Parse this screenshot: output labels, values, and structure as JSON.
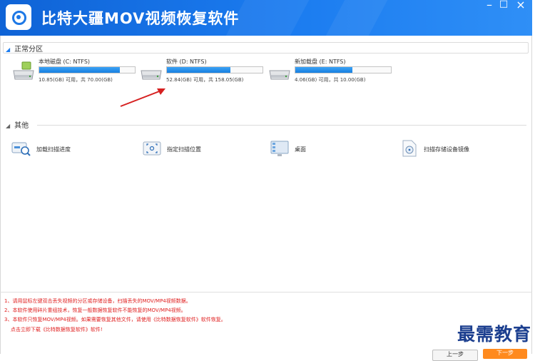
{
  "app": {
    "title": "比特大疆MOV视频恢复软件",
    "window_controls": {
      "minimize": "–",
      "maximize": "□",
      "close": "×"
    }
  },
  "sections": {
    "partitions_label": "正常分区",
    "other_label": "其他"
  },
  "drives": [
    {
      "name": "本地磁盘 (C: NTFS)",
      "usage": "10.85(GB) 可用，共 70.00(GB)",
      "used_fraction": 0.845,
      "icon": "hard-drive-icon"
    },
    {
      "name": "软件 (D: NTFS)",
      "usage": "52.84(GB) 可用，共 158.05(GB)",
      "used_fraction": 0.665,
      "icon": "hard-drive-icon"
    },
    {
      "name": "新加载盘 (E: NTFS)",
      "usage": "4.06(GB) 可用，共 10.00(GB)",
      "used_fraction": 0.594,
      "icon": "hard-drive-icon"
    }
  ],
  "tools": [
    {
      "label": "加载扫描进度",
      "icon": "load-progress-icon"
    },
    {
      "label": "指定扫描位置",
      "icon": "target-location-icon"
    },
    {
      "label": "桌面",
      "icon": "desktop-icon"
    },
    {
      "label": "扫描存储设备镜像",
      "icon": "disk-image-icon"
    }
  ],
  "notes": [
    "1、请用鼠标左键双击丢失视频的分区或存储设备，扫描丢失的MOV/MP4视频数据。",
    "2、本软件使用碎片重组技术，恢复一般数据恢复软件不能恢复的MOV/MP4视频。",
    "3、本软件只恢复MOV/MP4视频。如果需要恢复其他文件，请使用《比特数据恢复软件》软件恢复。",
    "    点击立即下载《比特数据恢复软件》软件!"
  ],
  "watermark": "最需教育",
  "buttons": {
    "back": "上一步",
    "next": "下一步"
  },
  "colors": {
    "title_bar": "#1b7cf0",
    "bar_fill": "#1f86e6",
    "notes_text": "#e02020",
    "next_button": "#ff8a1e"
  }
}
